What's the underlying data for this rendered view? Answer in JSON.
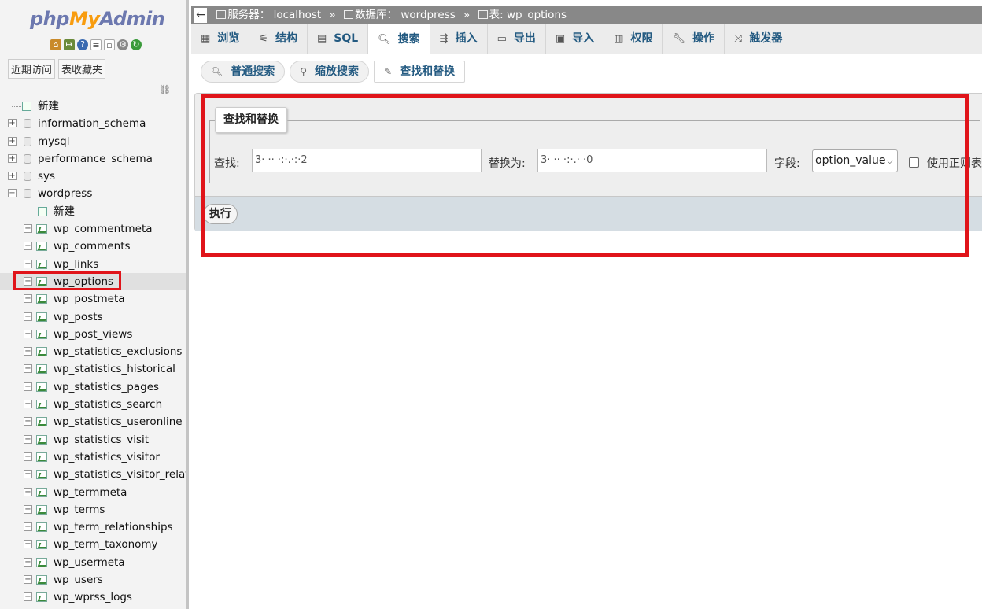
{
  "logo": {
    "php": "php",
    "my": "My",
    "admin": "Admin"
  },
  "nav": {
    "recent_label": "近期访问",
    "favorites_label": "表收藏夹",
    "tree": [
      {
        "label": "新建",
        "kind": "new",
        "level": 0
      },
      {
        "label": "information_schema",
        "kind": "db",
        "level": 0
      },
      {
        "label": "mysql",
        "kind": "db",
        "level": 0
      },
      {
        "label": "performance_schema",
        "kind": "db",
        "level": 0
      },
      {
        "label": "sys",
        "kind": "db",
        "level": 0
      },
      {
        "label": "wordpress",
        "kind": "db-open",
        "level": 0
      },
      {
        "label": "新建",
        "kind": "new",
        "level": 1
      },
      {
        "label": "wp_commentmeta",
        "kind": "table",
        "level": 1
      },
      {
        "label": "wp_comments",
        "kind": "table",
        "level": 1
      },
      {
        "label": "wp_links",
        "kind": "table",
        "level": 1
      },
      {
        "label": "wp_options",
        "kind": "table",
        "level": 1,
        "selected": true
      },
      {
        "label": "wp_postmeta",
        "kind": "table",
        "level": 1
      },
      {
        "label": "wp_posts",
        "kind": "table",
        "level": 1
      },
      {
        "label": "wp_post_views",
        "kind": "table",
        "level": 1
      },
      {
        "label": "wp_statistics_exclusions",
        "kind": "table",
        "level": 1
      },
      {
        "label": "wp_statistics_historical",
        "kind": "table",
        "level": 1
      },
      {
        "label": "wp_statistics_pages",
        "kind": "table",
        "level": 1
      },
      {
        "label": "wp_statistics_search",
        "kind": "table",
        "level": 1
      },
      {
        "label": "wp_statistics_useronline",
        "kind": "table",
        "level": 1
      },
      {
        "label": "wp_statistics_visit",
        "kind": "table",
        "level": 1
      },
      {
        "label": "wp_statistics_visitor",
        "kind": "table",
        "level": 1
      },
      {
        "label": "wp_statistics_visitor_relatio",
        "kind": "table",
        "level": 1
      },
      {
        "label": "wp_termmeta",
        "kind": "table",
        "level": 1
      },
      {
        "label": "wp_terms",
        "kind": "table",
        "level": 1
      },
      {
        "label": "wp_term_relationships",
        "kind": "table",
        "level": 1
      },
      {
        "label": "wp_term_taxonomy",
        "kind": "table",
        "level": 1
      },
      {
        "label": "wp_usermeta",
        "kind": "table",
        "level": 1
      },
      {
        "label": "wp_users",
        "kind": "table",
        "level": 1
      },
      {
        "label": "wp_wprss_logs",
        "kind": "table",
        "level": 1
      }
    ]
  },
  "breadcrumb": {
    "server_label": "服务器：",
    "server": "localhost",
    "db_label": "数据库：",
    "db": "wordpress",
    "table_label": "表: ",
    "table": "wp_options"
  },
  "tabs": [
    {
      "label": "浏览",
      "icon": "browse-icon"
    },
    {
      "label": "结构",
      "icon": "structure-icon"
    },
    {
      "label": "SQL",
      "icon": "sql-icon"
    },
    {
      "label": "搜索",
      "icon": "search-icon",
      "active": true
    },
    {
      "label": "插入",
      "icon": "insert-icon"
    },
    {
      "label": "导出",
      "icon": "export-icon"
    },
    {
      "label": "导入",
      "icon": "import-icon"
    },
    {
      "label": "权限",
      "icon": "privileges-icon"
    },
    {
      "label": "操作",
      "icon": "operations-icon"
    },
    {
      "label": "触发器",
      "icon": "triggers-icon"
    }
  ],
  "subtabs": [
    {
      "label": "普通搜索",
      "icon": "search-icon"
    },
    {
      "label": "缩放搜索",
      "icon": "zoom-search-icon"
    },
    {
      "label": "查找和替换",
      "icon": "find-replace-icon",
      "active": true
    }
  ],
  "form": {
    "legend": "查找和替换",
    "find_label": "查找:",
    "find_value": "3· ·· ·:·.·:·2",
    "replace_label": "替换为:",
    "replace_value": "3· ·· ·:·.· ·0",
    "column_label": "字段:",
    "column_value": "option_value",
    "regex_label": "使用正则表达式",
    "execute_label": "执行"
  }
}
